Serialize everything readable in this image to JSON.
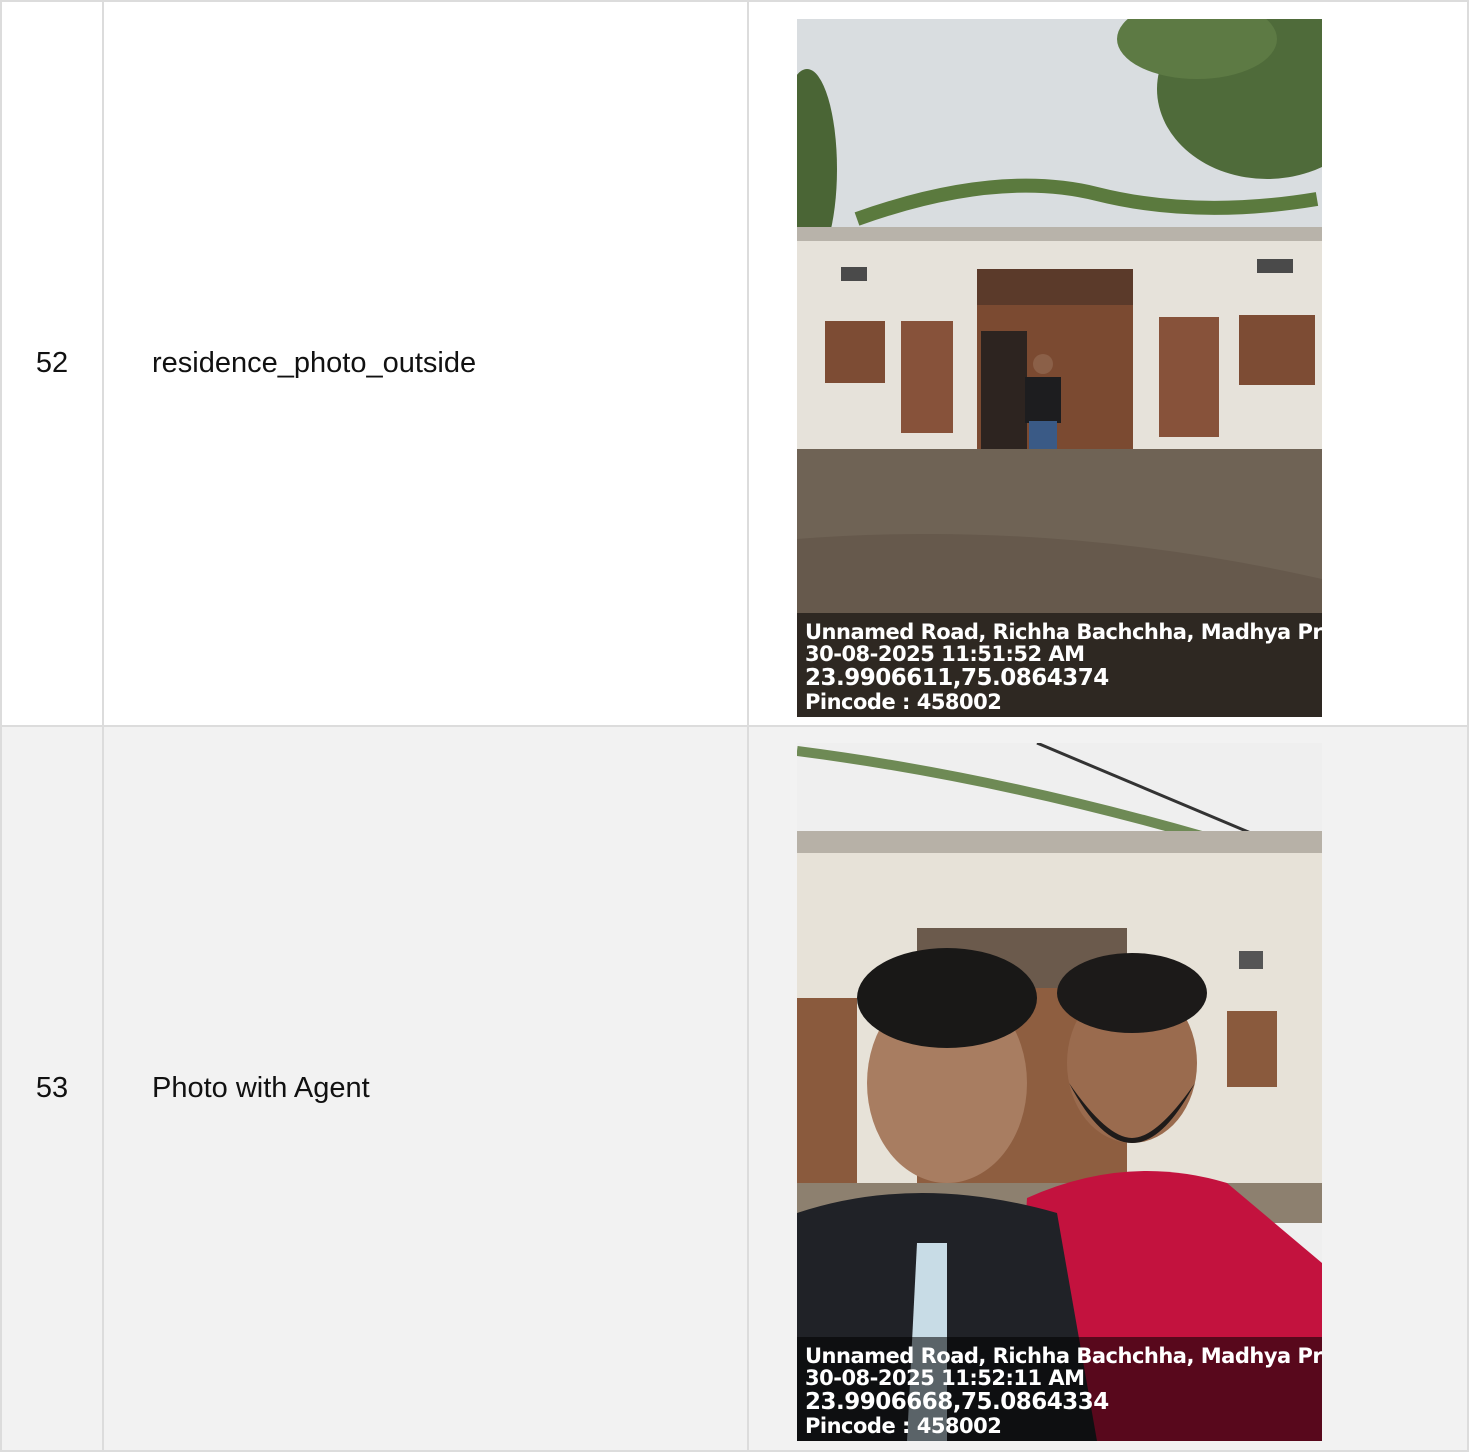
{
  "rows": [
    {
      "number": "52",
      "label": "residence_photo_outside",
      "photo_stamp": {
        "address": "Unnamed Road, Richha Bachchha, Madhya Prade",
        "datetime": "30-08-2025 11:51:52 AM",
        "coordinates": "23.9906611,75.0864374",
        "pincode": "Pincode : 458002"
      }
    },
    {
      "number": "53",
      "label": "Photo with Agent",
      "photo_stamp": {
        "address": "Unnamed Road, Richha Bachchha, Madhya Prade",
        "datetime": "30-08-2025 11:52:11 AM",
        "coordinates": "23.9906668,75.0864334",
        "pincode": "Pincode : 458002"
      }
    }
  ]
}
